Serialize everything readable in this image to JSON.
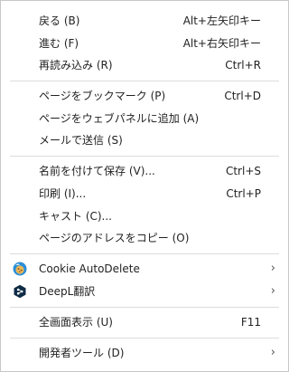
{
  "menu": {
    "back": {
      "label": "戻る (B)",
      "shortcut": "Alt+左矢印キー"
    },
    "forward": {
      "label": "進む (F)",
      "shortcut": "Alt+右矢印キー"
    },
    "reload": {
      "label": "再読み込み (R)",
      "shortcut": "Ctrl+R"
    },
    "bookmark": {
      "label": "ページをブックマーク (P)",
      "shortcut": "Ctrl+D"
    },
    "web_panel": {
      "label": "ページをウェブパネルに追加 (A)"
    },
    "send_mail": {
      "label": "メールで送信 (S)"
    },
    "save_as": {
      "label": "名前を付けて保存 (V)...",
      "shortcut": "Ctrl+S"
    },
    "print": {
      "label": "印刷 (I)...",
      "shortcut": "Ctrl+P"
    },
    "cast": {
      "label": "キャスト (C)..."
    },
    "copy_address": {
      "label": "ページのアドレスをコピー (O)"
    },
    "cookie_autodelete": {
      "label": "Cookie AutoDelete",
      "icon": "cookie-autodelete-icon"
    },
    "deepl": {
      "label": "DeepL翻訳",
      "icon": "deepl-icon"
    },
    "fullscreen": {
      "label": "全画面表示 (U)",
      "shortcut": "F11"
    },
    "devtools": {
      "label": "開発者ツール (D)"
    }
  },
  "colors": {
    "border": "#c8c8c8",
    "separator": "#dcdcdc",
    "text": "#222222",
    "cookie_icon_blue": "#2a8ed8",
    "deepl_icon_navy": "#0f2b46"
  }
}
